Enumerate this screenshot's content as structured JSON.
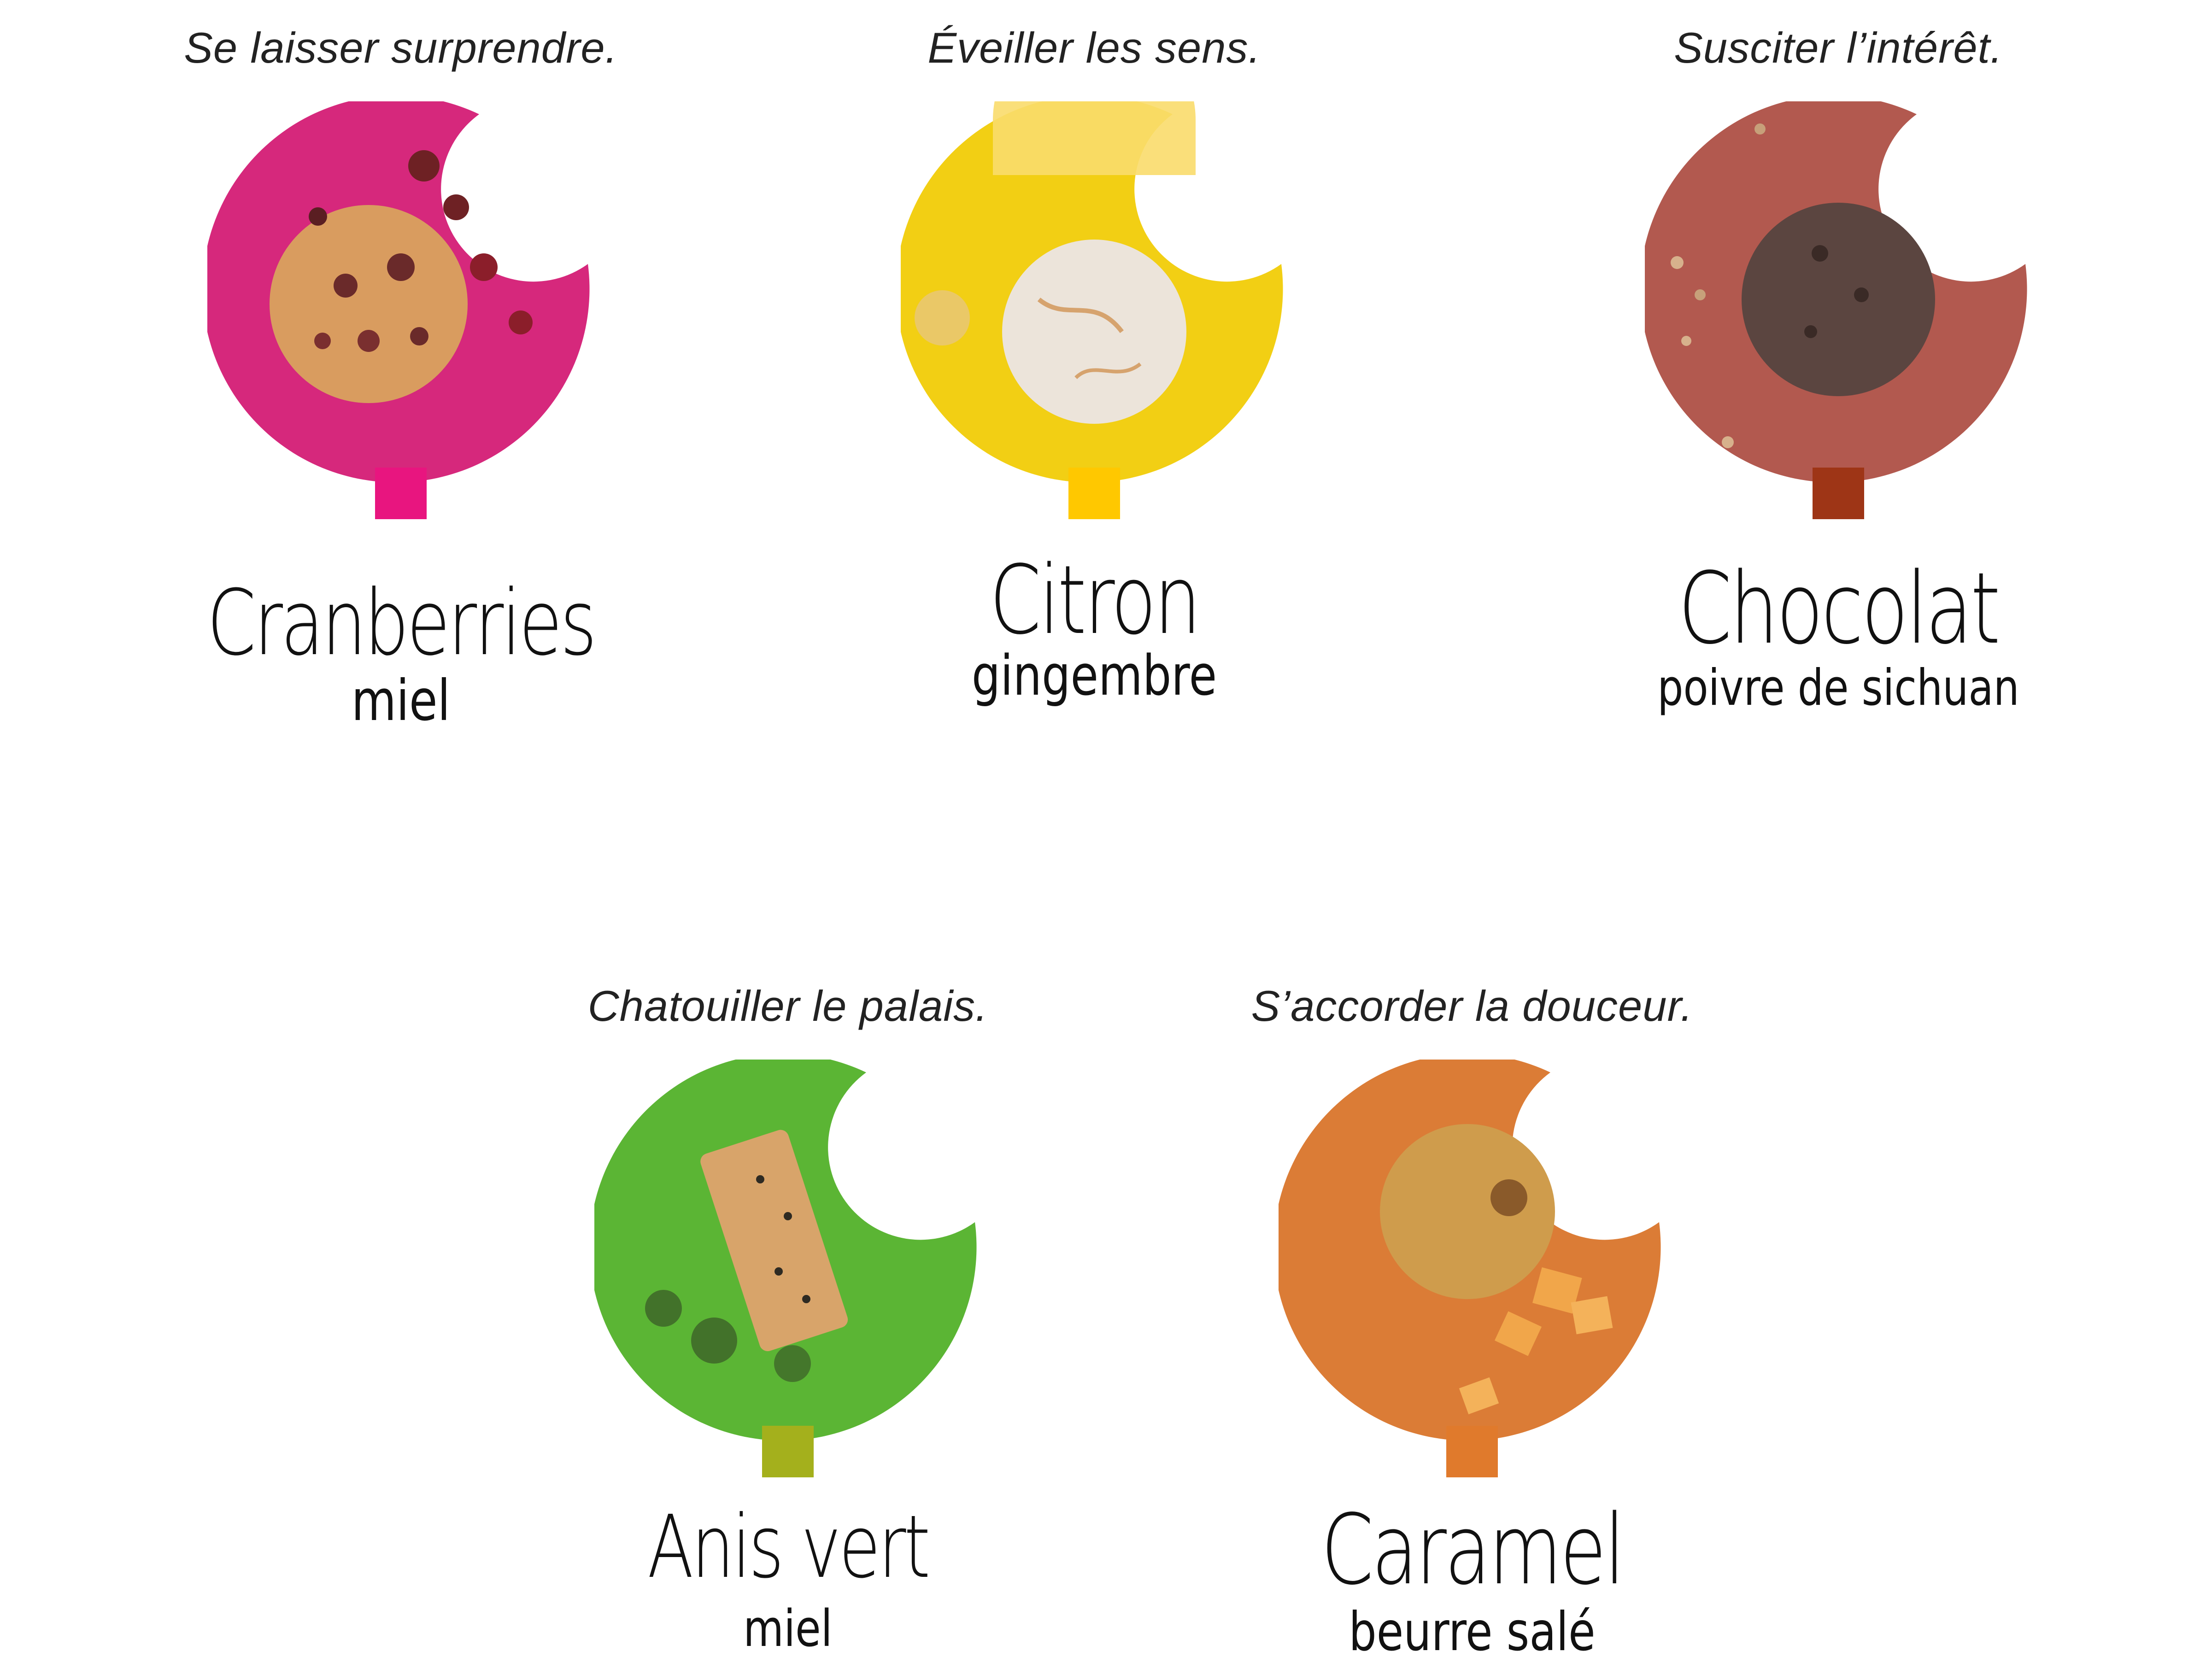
{
  "products": [
    {
      "tagline": "Se laisser surprendre.",
      "name": "Cranberries",
      "subtitle": "miel",
      "color": "#d6287c",
      "swatch": "#e8157f",
      "cookie": "#d9a25e",
      "icon": "cookie-cranberry-icon"
    },
    {
      "tagline": "Éveiller les sens.",
      "name": "Citron",
      "subtitle": "gingembre",
      "color": "#f2cf14",
      "swatch": "#ffc800",
      "cookie": "#ece4da",
      "icon": "cookie-lemon-icon"
    },
    {
      "tagline": "Susciter l’intérêt.",
      "name": "Chocolat",
      "subtitle": "poivre de sichuan",
      "color": "#b2594f",
      "swatch": "#9e3516",
      "cookie": "#5b4540",
      "icon": "cookie-chocolate-icon"
    },
    {
      "tagline": "Chatouiller le palais.",
      "name": "Anis vert",
      "subtitle": "miel",
      "color": "#5bb534",
      "swatch": "#a4b01c",
      "cookie": "#d8a46a",
      "icon": "cookie-anise-icon"
    },
    {
      "tagline": "S’accorder la douceur.",
      "name": "Caramel",
      "subtitle": "beurre salé",
      "color": "#db7c36",
      "swatch": "#e07a2c",
      "cookie": "#cf9c4c",
      "icon": "cookie-caramel-icon"
    }
  ]
}
